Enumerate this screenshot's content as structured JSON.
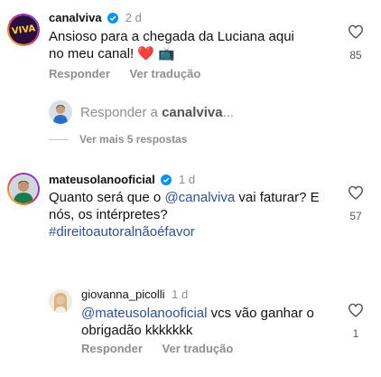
{
  "comments": [
    {
      "username": "canalviva",
      "time": "2 d",
      "avatar_text": "VIVA",
      "text": "Ansioso para a chegada da Luciana aqui no meu canal! ❤️ 📺",
      "reply_label": "Responder",
      "translate_label": "Ver tradução",
      "likes": "85"
    },
    {
      "username": "mateusolanooficial",
      "time": "1 d",
      "text_pre": "Quanto será que o ",
      "mention": "@canalviva",
      "text_post": " vai faturar? E nós, os intérpretes?",
      "hashtag": "#direitoautoralnãoéfavor",
      "likes": "57"
    },
    {
      "username": "giovanna_picolli",
      "time": "1 d",
      "mention": "@mateusolanooficial",
      "text_post": " vcs vão ganhar o obrigadão kkkkkkk",
      "reply_label": "Responder",
      "translate_label": "Ver tradução",
      "likes": "1"
    }
  ],
  "reply_prompt": {
    "prefix": "Responder a ",
    "target": "canalviva",
    "suffix": "..."
  },
  "view_more": "Ver mais 5 respostas",
  "colors": {
    "verified": "#0095f6",
    "viva_bg": "#2a0f3d",
    "viva_text": "#ffd21f",
    "mention": "#2d4f9e"
  }
}
